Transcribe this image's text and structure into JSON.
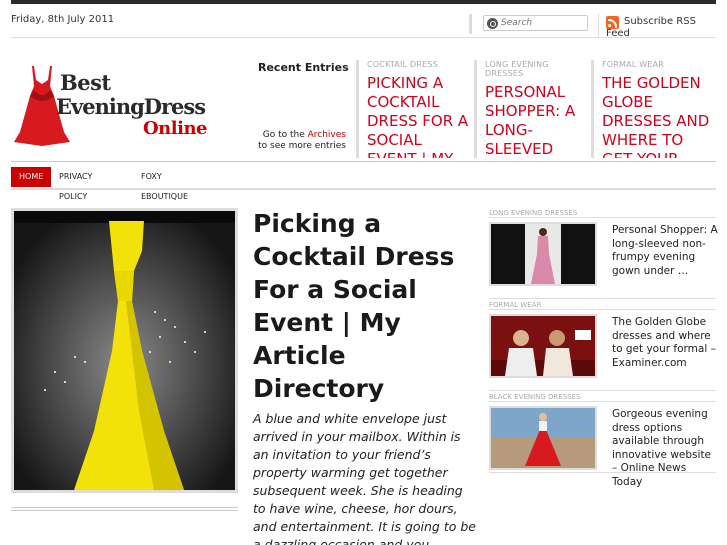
{
  "header": {
    "date": "Friday, 8th July 2011",
    "search_placeholder": "Search",
    "rss_label": "Subscribe RSS Feed"
  },
  "logo": {
    "line1": "Best",
    "line2": "EveningDress",
    "line3": "Online"
  },
  "recent": {
    "title": "Recent Entries",
    "goto_prefix": "Go to the",
    "goto_link": "Archives",
    "goto_suffix": "to see more entries",
    "entries": [
      {
        "category": "Cocktail Dress",
        "title": "Picking a Cocktail Dress For a Social Event | My Article Directory"
      },
      {
        "category": "Long Evening Dresses",
        "title": "Personal Shopper: A long-sleeved non-frumpy evening gown"
      },
      {
        "category": "Formal Wear",
        "title": "The Golden Globe dresses and where to get your formal"
      }
    ]
  },
  "nav": {
    "items": [
      "HOME",
      "PRIVACY POLICY",
      "FOXY EBOUTIQUE"
    ]
  },
  "article": {
    "title": "Picking a Cocktail Dress For a Social Event | My Article Directory",
    "excerpt": "A blue and white envelope just arrived in your mailbox. Within is an invitation to your friend’s property warming get together subsequent week. She is heading to have wine, cheese, hor dours, and entertainment. It is going to be a dazzling occasion and you"
  },
  "sidebar": {
    "items": [
      {
        "category": "Long Evening Dresses",
        "title": "Personal Shopper: A long-sleeved non-frumpy evening gown under …"
      },
      {
        "category": "Formal Wear",
        "title": "The Golden Globe dresses and where to get your formal – Examiner.com"
      },
      {
        "category": "Black Evening Dresses",
        "title": "Gorgeous evening dress options available through innovative website – Online News Today"
      }
    ]
  },
  "colors": {
    "accent": "#c00000",
    "feature_title": "#d0021b",
    "dress_yellow": "#f2e20a",
    "dress_red": "#d71920"
  }
}
